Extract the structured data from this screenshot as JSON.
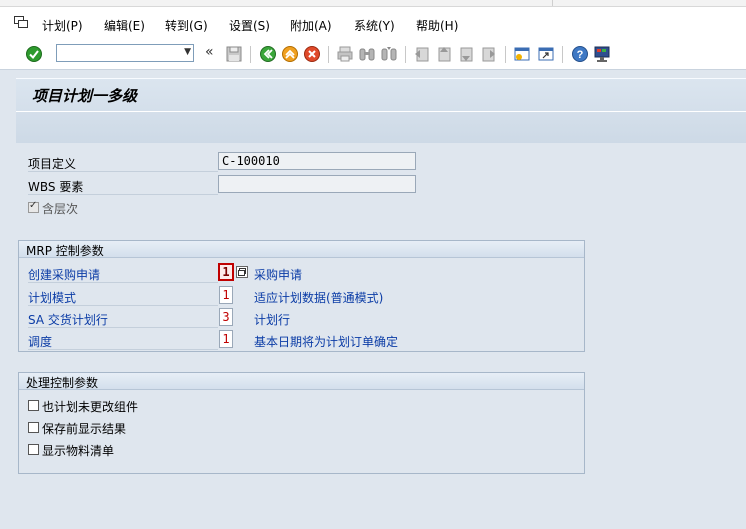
{
  "menu": {
    "items": [
      "计划(P)",
      "编辑(E)",
      "转到(G)",
      "设置(S)",
      "附加(A)",
      "系统(Y)",
      "帮助(H)"
    ]
  },
  "toolbar": {
    "command_value": "",
    "back_chevrons": "«"
  },
  "title": "项目计划一多级",
  "header_fields": {
    "project_label": "项目定义",
    "project_value": "C-100010",
    "wbs_label": "WBS 要素",
    "wbs_value": "",
    "hierarchy_label": "含层次"
  },
  "mrp_group": {
    "title": "MRP 控制参数",
    "rows": [
      {
        "label": "创建采购申请",
        "value": "1",
        "desc": "采购申请"
      },
      {
        "label": "计划模式",
        "value": "1",
        "desc": "适应计划数据(普通模式)"
      },
      {
        "label": "SA 交货计划行",
        "value": "3",
        "desc": "计划行"
      },
      {
        "label": "调度",
        "value": "1",
        "desc": "基本日期将为计划订单确定"
      }
    ]
  },
  "proc_group": {
    "title": "处理控制参数",
    "options": [
      "也计划未更改组件",
      "保存前显示结果",
      "显示物料清单"
    ]
  },
  "colors": {
    "label_blue": "#0b3ca6",
    "value_red": "#c00000",
    "background": "#dfe6ee"
  }
}
